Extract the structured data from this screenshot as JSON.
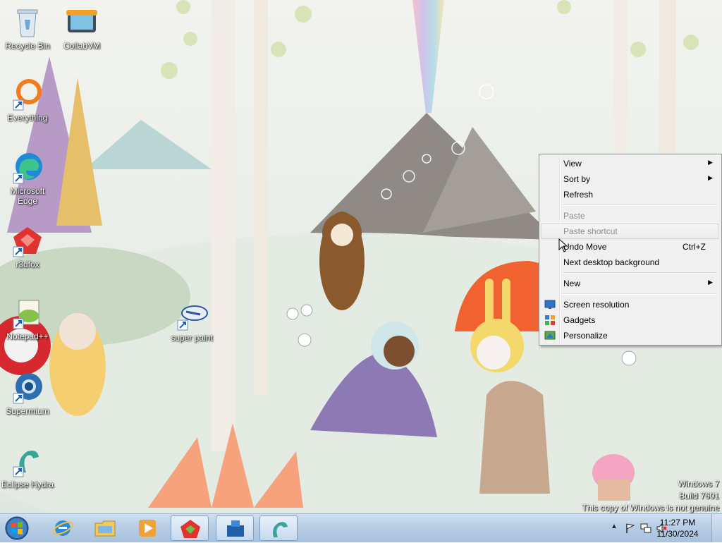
{
  "desktop": {
    "icons": [
      {
        "label": "Recycle Bin",
        "icon": "recycle-bin-icon"
      },
      {
        "label": "CollabVM",
        "icon": "collabvm-icon"
      },
      {
        "label": "Everything",
        "icon": "everything-icon"
      },
      {
        "label": "Microsoft Edge",
        "icon": "edge-icon"
      },
      {
        "label": "r3dfox",
        "icon": "r3dfox-icon"
      },
      {
        "label": "Notepad++",
        "icon": "notepadpp-icon"
      },
      {
        "label": "Supermium",
        "icon": "supermium-icon"
      },
      {
        "label": "Eclipse Hydra",
        "icon": "eclipse-hydra-icon"
      },
      {
        "label": "super paint",
        "icon": "super-paint-icon"
      }
    ]
  },
  "context_menu": {
    "items": [
      {
        "label": "View",
        "submenu": true
      },
      {
        "label": "Sort by",
        "submenu": true
      },
      {
        "label": "Refresh"
      },
      {
        "label": "Paste",
        "disabled": true
      },
      {
        "label": "Paste shortcut",
        "disabled": true
      },
      {
        "label": "Undo Move",
        "shortcut": "Ctrl+Z"
      },
      {
        "label": "Next desktop background"
      },
      {
        "label": "New",
        "submenu": true
      },
      {
        "label": "Screen resolution",
        "icon": "screen-resolution-icon"
      },
      {
        "label": "Gadgets",
        "icon": "gadgets-icon"
      },
      {
        "label": "Personalize",
        "icon": "personalize-icon"
      }
    ]
  },
  "watermark": {
    "line1": "Windows 7",
    "line2": "Build 7601",
    "line3": "This copy of Windows is not genuine"
  },
  "taskbar": {
    "pinned": [
      "internet-explorer-icon",
      "windows-explorer-icon",
      "media-player-icon",
      "r3dfox-task-icon",
      "app-task-icon",
      "eclipse-hydra-task-icon"
    ],
    "clock_time": "11:27 PM",
    "clock_date": "11/30/2024",
    "accent": "#3a78c3"
  }
}
